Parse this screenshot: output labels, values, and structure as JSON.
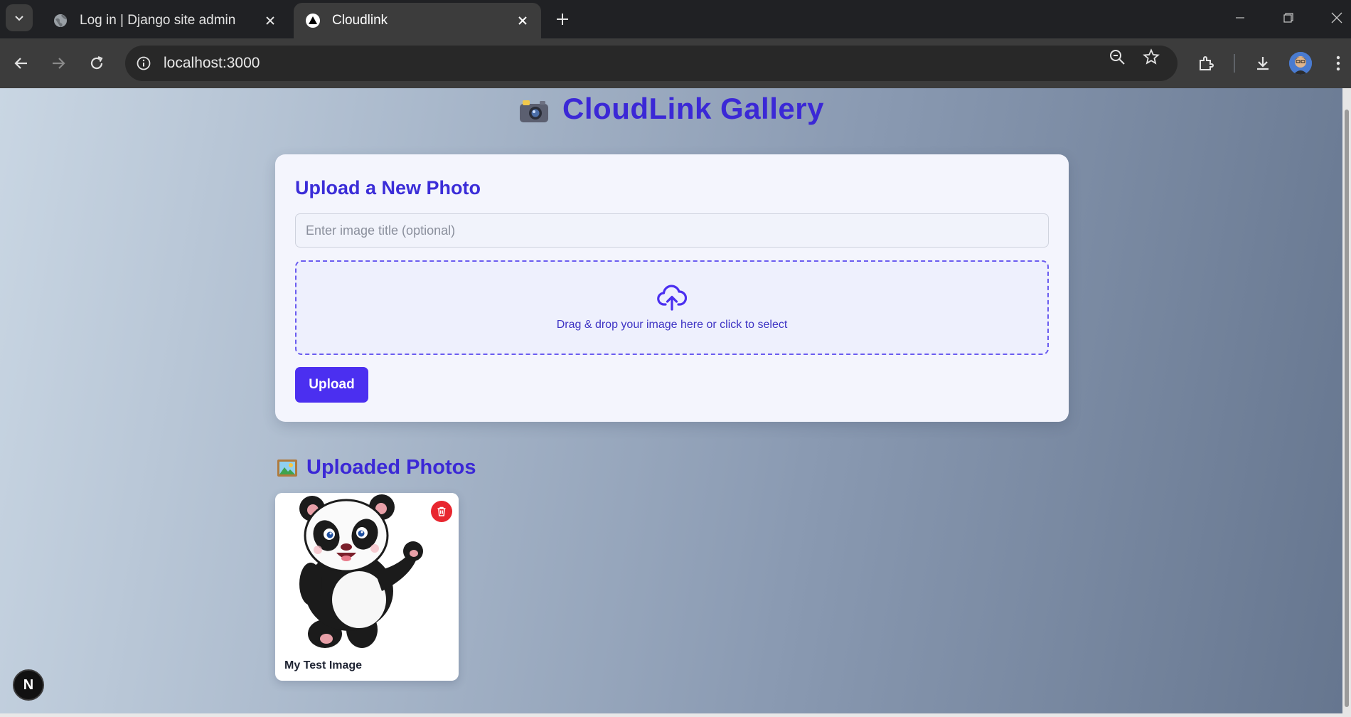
{
  "browser": {
    "tabs": [
      {
        "title": "Log in | Django site admin",
        "active": false
      },
      {
        "title": "Cloudlink",
        "active": true
      }
    ],
    "address": "localhost:3000",
    "icons": [
      "tab-search-icon",
      "globe-icon",
      "next-icon",
      "close-icon",
      "new-tab-icon",
      "minimize-icon",
      "restore-icon",
      "window-close-icon",
      "back-icon",
      "forward-icon",
      "reload-icon",
      "info-icon",
      "zoom-icon",
      "star-icon",
      "extensions-icon",
      "download-icon",
      "menu-icon"
    ]
  },
  "page": {
    "title": "CloudLink Gallery",
    "title_icon": "camera-icon",
    "upload_card": {
      "heading": "Upload a New Photo",
      "title_placeholder": "Enter image title (optional)",
      "title_value": "",
      "dropzone_text": "Drag & drop your image here or click to select",
      "dropzone_icon": "cloud-upload-icon",
      "upload_button": "Upload"
    },
    "gallery": {
      "heading": "Uploaded Photos",
      "heading_icon": "framed-picture-icon",
      "photos": [
        {
          "title": "My Test Image",
          "image": "cartoon panda waving",
          "delete_icon": "trash-icon"
        }
      ]
    },
    "dev_badge": "N"
  },
  "colors": {
    "accent": "#4b2ff0",
    "heading": "#3b28d6",
    "delete": "#e8262f"
  }
}
